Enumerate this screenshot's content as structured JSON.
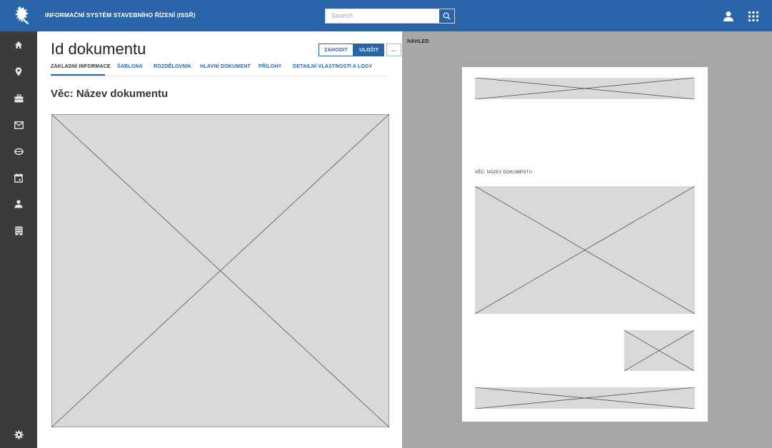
{
  "header": {
    "app_title": "INFORMAČNÍ SYSTÉM STAVEBNÍHO ŘÍZENÍ (ISSŘ)",
    "search_placeholder": "Search",
    "logo_icon": "lion-emblem-icon",
    "search_icon": "search-icon",
    "user_icon": "user-icon",
    "apps_icon": "apps-grid-icon",
    "brand_color": "#2a64a8"
  },
  "sidebar": {
    "items": [
      {
        "name": "home",
        "icon": "home-icon"
      },
      {
        "name": "location",
        "icon": "location-pin-icon"
      },
      {
        "name": "briefcase",
        "icon": "briefcase-icon"
      },
      {
        "name": "mail",
        "icon": "mail-icon"
      },
      {
        "name": "storage",
        "icon": "database-icon"
      },
      {
        "name": "calendar",
        "icon": "calendar-icon"
      },
      {
        "name": "person",
        "icon": "person-icon"
      },
      {
        "name": "building",
        "icon": "building-icon"
      }
    ],
    "bottom_icon": "gear-icon",
    "background": "#3b3b3b"
  },
  "editor": {
    "title": "Id dokumentu",
    "actions": {
      "discard": "ZAHODIT",
      "save": "ULOŽIT",
      "more": "..."
    },
    "tabs": [
      {
        "label": "ZÁKLADNÍ INFORMACE",
        "active": true
      },
      {
        "label": "ŠABLONA",
        "active": false
      },
      {
        "label": "ROZDĚLOVNÍK",
        "active": false
      },
      {
        "label": "HLAVNÍ DOKUMENT",
        "active": false
      },
      {
        "label": "PŘÍLOHY",
        "active": false
      },
      {
        "label": "DETAILNÍ VLASTNOSTI A LOGY",
        "active": false
      }
    ],
    "subject": "Věc: Název dokumentu"
  },
  "preview": {
    "label": "NÁHLED",
    "subject": "VĚC: NÁZEV DOKUMENTU",
    "background": "#a7a7a7"
  }
}
